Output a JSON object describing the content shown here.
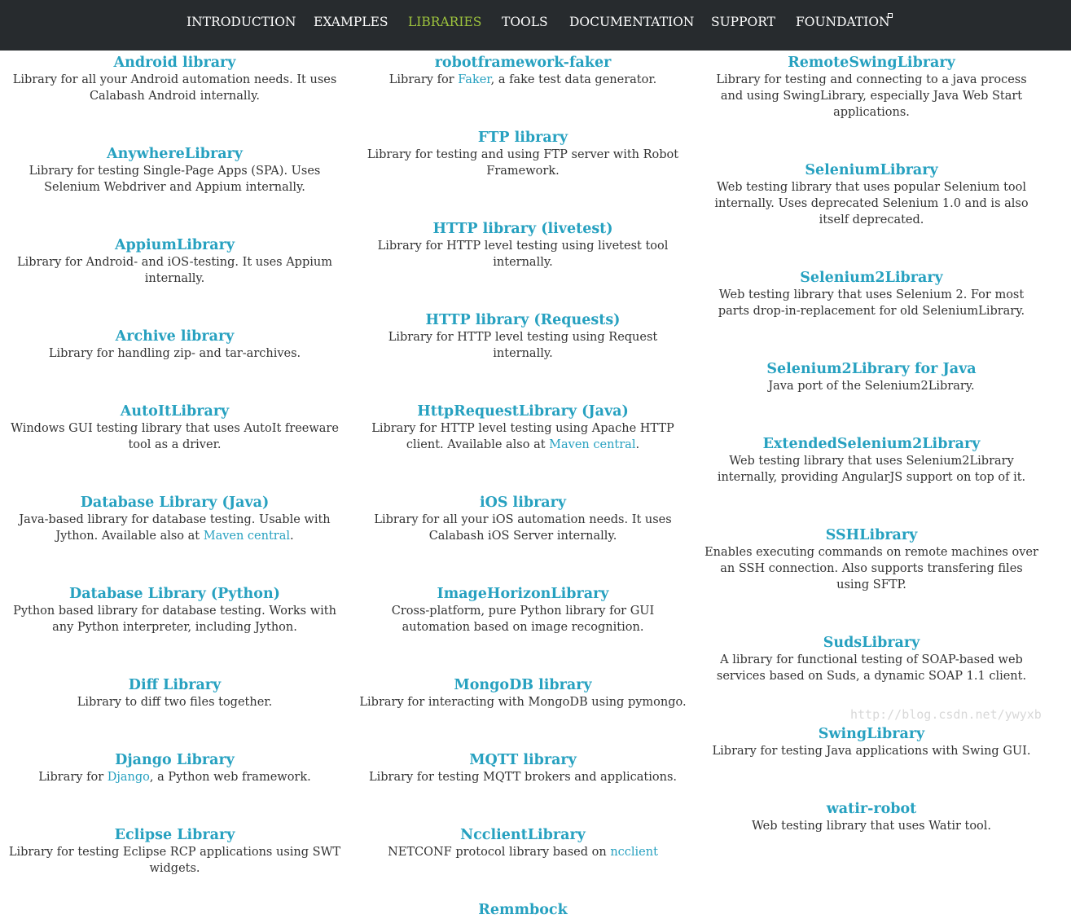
{
  "nav": {
    "items": [
      "INTRODUCTION",
      "EXAMPLES",
      "LIBRARIES",
      "TOOLS",
      "DOCUMENTATION",
      "SUPPORT",
      "FOUNDATION"
    ],
    "active": "LIBRARIES",
    "external_icon": "external-link-icon",
    "colors": {
      "background": "#272b2e",
      "text": "#ffffff",
      "active": "#9dc33d"
    }
  },
  "accent_color": "#27a1c0",
  "col1": [
    {
      "name": "Android library",
      "desc": "Library for all your Android automation needs. It uses Calabash Android internally."
    },
    {
      "name": "AnywhereLibrary",
      "desc": "Library for testing Single-Page Apps (SPA). Uses Selenium Webdriver and Appium internally."
    },
    {
      "name": "AppiumLibrary",
      "desc": "Library for Android- and iOS-testing. It uses Appium internally."
    },
    {
      "name": "Archive library",
      "desc": "Library for handling zip- and tar-archives."
    },
    {
      "name": "AutoItLibrary",
      "desc": "Windows GUI testing library that uses AutoIt freeware tool as a driver."
    },
    {
      "name": "Database Library (Java)",
      "desc_pre": "Java-based library for database testing. Usable with Jython. Available also at ",
      "link": "Maven central",
      "desc_post": "."
    },
    {
      "name": "Database Library (Python)",
      "desc": "Python based library for database testing. Works with any Python interpreter, including Jython."
    },
    {
      "name": "Diff Library",
      "desc": "Library to diff two files together."
    },
    {
      "name": "Django Library",
      "desc_pre": "Library for ",
      "link": "Django",
      "desc_post": ", a Python web framework."
    },
    {
      "name": "Eclipse Library",
      "desc": "Library for testing Eclipse RCP applications using SWT widgets."
    }
  ],
  "col2": [
    {
      "name": "robotframework-faker",
      "desc_pre": "Library for ",
      "link": "Faker",
      "desc_post": ", a fake test data generator."
    },
    {
      "name": "FTP library",
      "desc": "Library for testing and using FTP server with Robot Framework."
    },
    {
      "name": "HTTP library (livetest)",
      "desc": "Library for HTTP level testing using livetest tool internally."
    },
    {
      "name": "HTTP library (Requests)",
      "desc": "Library for HTTP level testing using Request internally."
    },
    {
      "name": "HttpRequestLibrary (Java)",
      "desc_pre": "Library for HTTP level testing using Apache HTTP client. Available also at ",
      "link": "Maven central",
      "desc_post": "."
    },
    {
      "name": "iOS library",
      "desc": "Library for all your iOS automation needs. It uses Calabash iOS Server internally."
    },
    {
      "name": "ImageHorizonLibrary",
      "desc": "Cross-platform, pure Python library for GUI automation based on image recognition."
    },
    {
      "name": "MongoDB library",
      "desc": "Library for interacting with MongoDB using pymongo."
    },
    {
      "name": "MQTT library",
      "desc": "Library for testing MQTT brokers and applications."
    },
    {
      "name": "NcclientLibrary",
      "desc_pre": "NETCONF protocol library based on ",
      "link": "ncclient",
      "desc_post": ""
    },
    {
      "name": "Remmbock",
      "desc": ""
    }
  ],
  "col3": [
    {
      "name": "RemoteSwingLibrary",
      "desc": "Library for testing and connecting to a java process and using SwingLibrary, especially Java Web Start applications."
    },
    {
      "name": "SeleniumLibrary",
      "desc": "Web testing library that uses popular Selenium tool internally. Uses deprecated Selenium 1.0 and is also itself deprecated."
    },
    {
      "name": "Selenium2Library",
      "desc": "Web testing library that uses Selenium 2. For most parts drop-in-replacement for old SeleniumLibrary."
    },
    {
      "name": "Selenium2Library for Java",
      "desc": "Java port of the Selenium2Library."
    },
    {
      "name": "ExtendedSelenium2Library",
      "desc": "Web testing library that uses Selenium2Library internally, providing AngularJS support on top of it."
    },
    {
      "name": "SSHLibrary",
      "desc": "Enables executing commands on remote machines over an SSH connection. Also supports transfering files using SFTP."
    },
    {
      "name": "SudsLibrary",
      "desc": "A library for functional testing of SOAP-based web services based on Suds, a dynamic SOAP 1.1 client."
    },
    {
      "name": "SwingLibrary",
      "desc": "Library for testing Java applications with Swing GUI."
    },
    {
      "name": "watir-robot",
      "desc": "Web testing library that uses Watir tool."
    }
  ],
  "watermark": "http://blog.csdn.net/ywyxb"
}
